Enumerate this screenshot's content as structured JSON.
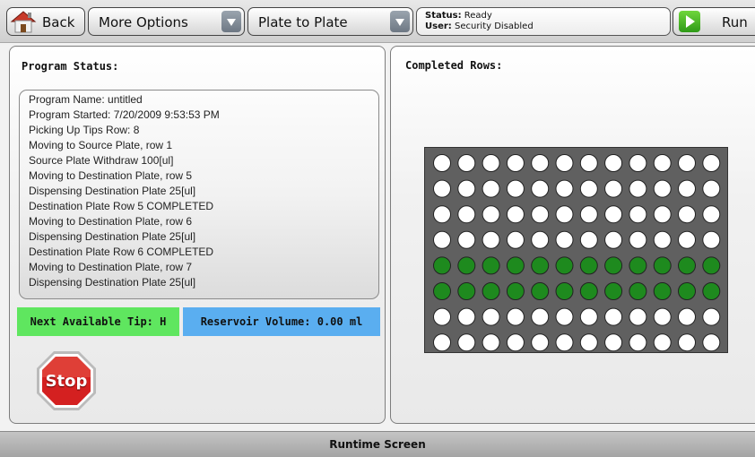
{
  "toolbar": {
    "back_label": "Back",
    "more_options_label": "More Options",
    "mode_label": "Plate to Plate",
    "status_key": "Status:",
    "status_value": "Ready",
    "user_key": "User:",
    "user_value": "Security Disabled",
    "run_label": "Run"
  },
  "left_panel": {
    "title": "Program Status:",
    "log": [
      "Program Name: untitled",
      "Program Started: 7/20/2009 9:53:53 PM",
      "Picking Up Tips Row: 8",
      "Moving to Source Plate, row 1",
      "Source Plate Withdraw 100[ul]",
      "Moving to Destination Plate, row 5",
      "Dispensing Destination Plate 25[ul]",
      "Destination Plate Row 5 COMPLETED",
      "Moving to Destination Plate, row 6",
      "Dispensing Destination Plate 25[ul]",
      "Destination Plate Row 6 COMPLETED",
      "Moving to Destination Plate, row 7",
      "Dispensing Destination Plate 25[ul]"
    ],
    "next_tip": "Next Available Tip: H",
    "reservoir": "Reservoir Volume: 0.00 ml",
    "stop_label": "Stop"
  },
  "right_panel": {
    "title": "Completed Rows:",
    "plate": {
      "columns": 12,
      "completed_rows": [
        false,
        false,
        false,
        false,
        true,
        true,
        false,
        false
      ],
      "well_empty_color": "#ffffff",
      "well_done_color": "#1e8a1e"
    }
  },
  "footer": {
    "label": "Runtime Screen"
  },
  "colors": {
    "next_tip_bg": "#5fe65f",
    "reservoir_bg": "#5aaef0",
    "stop_red": "#d42020"
  }
}
